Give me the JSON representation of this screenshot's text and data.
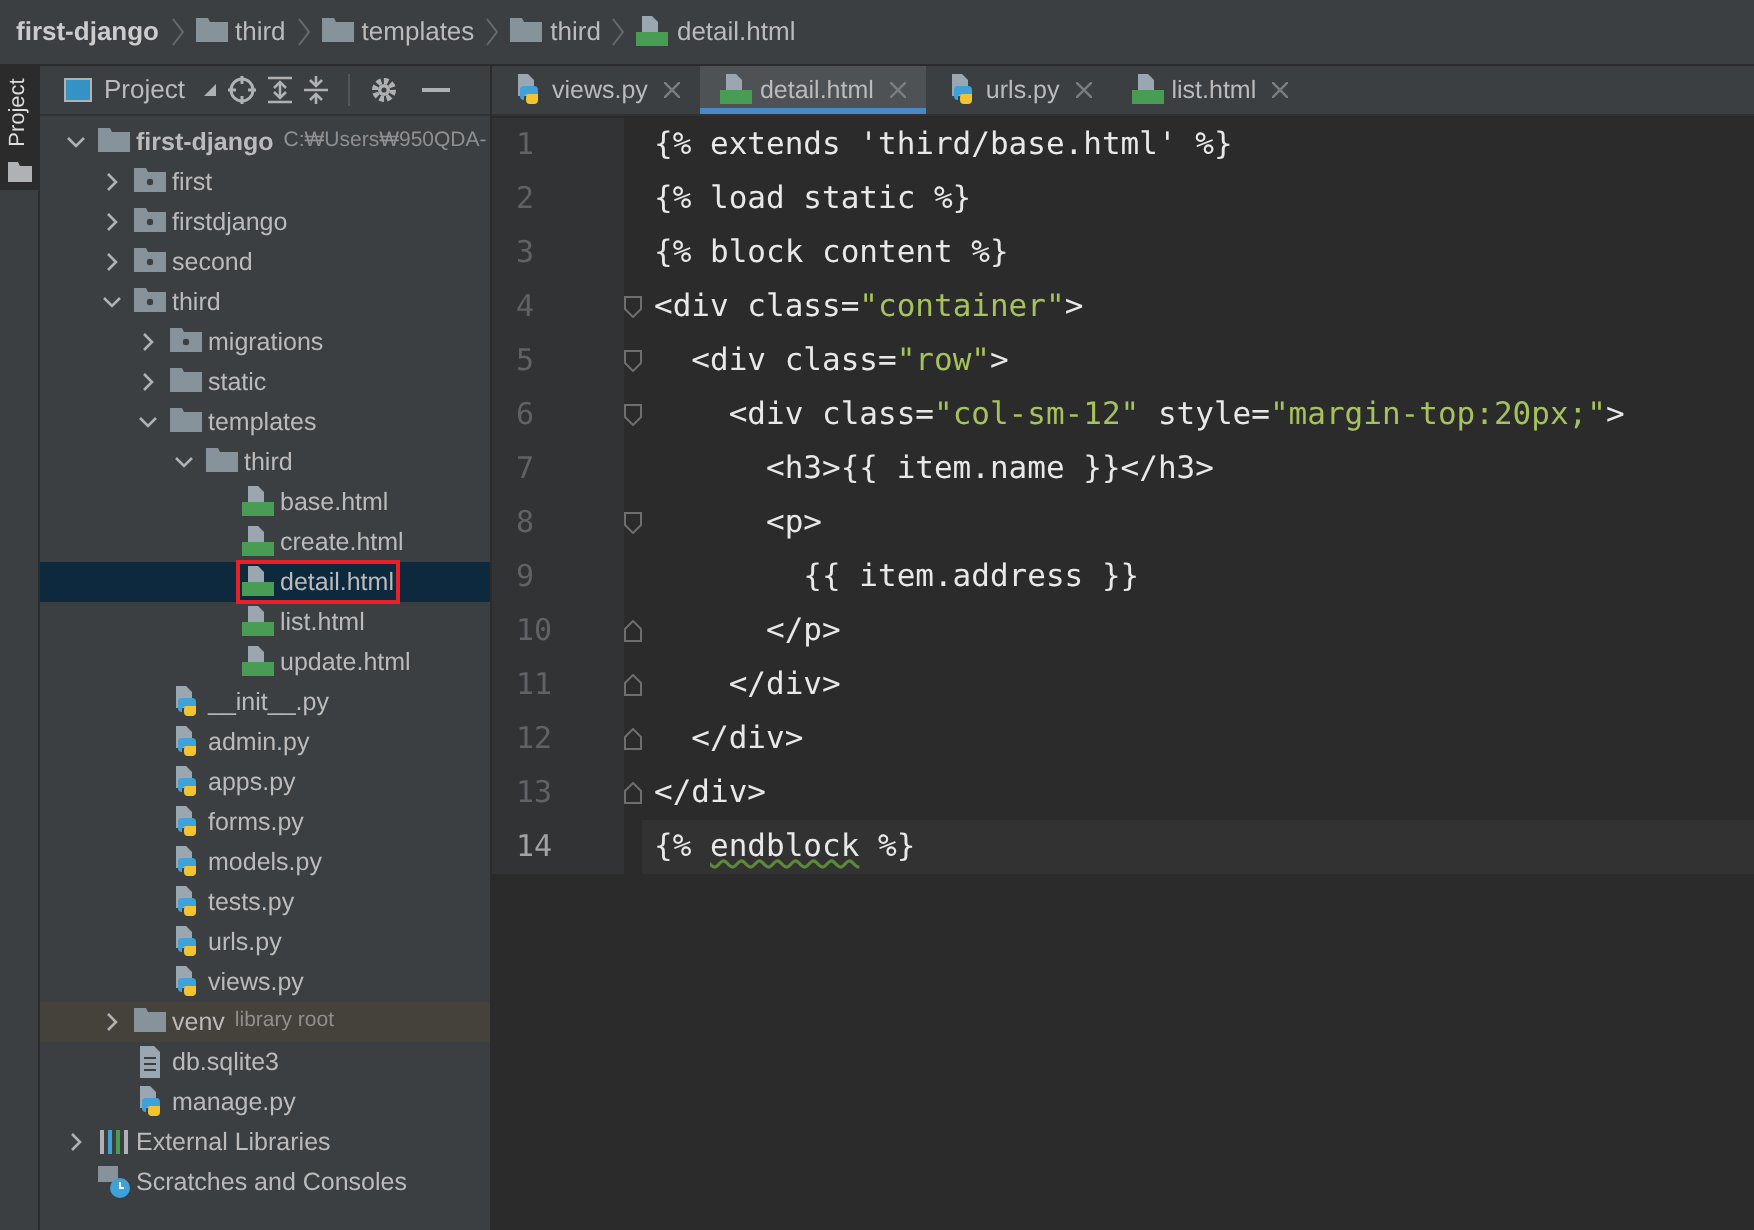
{
  "breadcrumbs": [
    {
      "label": "first-django",
      "kind": "root"
    },
    {
      "label": "third",
      "kind": "folder"
    },
    {
      "label": "templates",
      "kind": "folder"
    },
    {
      "label": "third",
      "kind": "folder"
    },
    {
      "label": "detail.html",
      "kind": "html"
    }
  ],
  "side_strip": {
    "label": "Project"
  },
  "project_toolbar": {
    "label": "Project"
  },
  "tree": [
    {
      "label": "first-django",
      "hint": "C:₩Users₩950QDA-",
      "kind": "folder",
      "expanded": true,
      "selected": false,
      "children": [
        {
          "label": "first",
          "kind": "package",
          "expanded": false,
          "selected": false
        },
        {
          "label": "firstdjango",
          "kind": "package",
          "expanded": false,
          "selected": false
        },
        {
          "label": "second",
          "kind": "package",
          "expanded": false,
          "selected": false
        },
        {
          "label": "third",
          "kind": "package",
          "expanded": true,
          "selected": false,
          "children": [
            {
              "label": "migrations",
              "kind": "package",
              "expanded": false,
              "selected": false
            },
            {
              "label": "static",
              "kind": "folder",
              "expanded": false,
              "selected": false
            },
            {
              "label": "templates",
              "kind": "folder",
              "expanded": true,
              "selected": false,
              "children": [
                {
                  "label": "third",
                  "kind": "folder",
                  "expanded": true,
                  "selected": false,
                  "children": [
                    {
                      "label": "base.html",
                      "kind": "html",
                      "selected": false
                    },
                    {
                      "label": "create.html",
                      "kind": "html",
                      "selected": false
                    },
                    {
                      "label": "detail.html",
                      "kind": "html",
                      "selected": true,
                      "highlighted": true
                    },
                    {
                      "label": "list.html",
                      "kind": "html",
                      "selected": false
                    },
                    {
                      "label": "update.html",
                      "kind": "html",
                      "selected": false
                    }
                  ]
                }
              ]
            },
            {
              "label": "__init__.py",
              "kind": "py",
              "selected": false
            },
            {
              "label": "admin.py",
              "kind": "py",
              "selected": false
            },
            {
              "label": "apps.py",
              "kind": "py",
              "selected": false
            },
            {
              "label": "forms.py",
              "kind": "py",
              "selected": false
            },
            {
              "label": "models.py",
              "kind": "py",
              "selected": false
            },
            {
              "label": "tests.py",
              "kind": "py",
              "selected": false
            },
            {
              "label": "urls.py",
              "kind": "py",
              "selected": false
            },
            {
              "label": "views.py",
              "kind": "py",
              "selected": false
            }
          ]
        },
        {
          "label": "venv",
          "hint": "library root",
          "kind": "libfolder",
          "expanded": false,
          "selected": false
        },
        {
          "label": "db.sqlite3",
          "kind": "file",
          "selected": false
        },
        {
          "label": "manage.py",
          "kind": "py",
          "selected": false
        }
      ]
    },
    {
      "label": "External Libraries",
      "kind": "libraries",
      "expanded": false,
      "selected": false
    },
    {
      "label": "Scratches and Consoles",
      "kind": "scratches",
      "selected": false
    }
  ],
  "tabs": [
    {
      "label": "views.py",
      "kind": "py",
      "selected": false
    },
    {
      "label": "detail.html",
      "kind": "html",
      "selected": true
    },
    {
      "label": "urls.py",
      "kind": "py",
      "selected": false
    },
    {
      "label": "list.html",
      "kind": "html",
      "selected": false
    }
  ],
  "code": [
    {
      "number": "1",
      "fold_start": false,
      "fold_end": false,
      "current": false,
      "tokens": [
        {
          "text": "{% extends 'third/base.html' %}",
          "kind": "plain"
        }
      ]
    },
    {
      "number": "2",
      "fold_start": false,
      "fold_end": false,
      "current": false,
      "tokens": [
        {
          "text": "{% load static %}",
          "kind": "plain"
        }
      ]
    },
    {
      "number": "3",
      "fold_start": false,
      "fold_end": false,
      "current": false,
      "tokens": [
        {
          "text": "{% block content %}",
          "kind": "plain"
        }
      ]
    },
    {
      "number": "4",
      "fold_start": true,
      "fold_end": false,
      "current": false,
      "tokens": [
        {
          "text": "<div class=",
          "kind": "plain"
        },
        {
          "text": "\"container\"",
          "kind": "string"
        },
        {
          "text": ">",
          "kind": "plain"
        }
      ]
    },
    {
      "number": "5",
      "fold_start": true,
      "fold_end": false,
      "current": false,
      "tokens": [
        {
          "text": "  <div class=",
          "kind": "plain"
        },
        {
          "text": "\"row\"",
          "kind": "string"
        },
        {
          "text": ">",
          "kind": "plain"
        }
      ]
    },
    {
      "number": "6",
      "fold_start": true,
      "fold_end": false,
      "current": false,
      "tokens": [
        {
          "text": "    <div class=",
          "kind": "plain"
        },
        {
          "text": "\"col-sm-12\"",
          "kind": "string"
        },
        {
          "text": " style=",
          "kind": "plain"
        },
        {
          "text": "\"margin-top:20px;\"",
          "kind": "string"
        },
        {
          "text": ">",
          "kind": "plain"
        }
      ]
    },
    {
      "number": "7",
      "fold_start": false,
      "fold_end": false,
      "current": false,
      "tokens": [
        {
          "text": "      <h3>{{ item.name }}</h3>",
          "kind": "plain"
        }
      ]
    },
    {
      "number": "8",
      "fold_start": true,
      "fold_end": false,
      "current": false,
      "tokens": [
        {
          "text": "      <p>",
          "kind": "plain"
        }
      ]
    },
    {
      "number": "9",
      "fold_start": false,
      "fold_end": false,
      "current": false,
      "tokens": [
        {
          "text": "        {{ item.address }}",
          "kind": "plain"
        }
      ]
    },
    {
      "number": "10",
      "fold_start": false,
      "fold_end": true,
      "current": false,
      "tokens": [
        {
          "text": "      </p>",
          "kind": "plain"
        }
      ]
    },
    {
      "number": "11",
      "fold_start": false,
      "fold_end": true,
      "current": false,
      "tokens": [
        {
          "text": "    </div>",
          "kind": "plain"
        }
      ]
    },
    {
      "number": "12",
      "fold_start": false,
      "fold_end": true,
      "current": false,
      "tokens": [
        {
          "text": "  </div>",
          "kind": "plain"
        }
      ]
    },
    {
      "number": "13",
      "fold_start": false,
      "fold_end": true,
      "current": false,
      "tokens": [
        {
          "text": "</div>",
          "kind": "plain"
        }
      ]
    },
    {
      "number": "14",
      "fold_start": false,
      "fold_end": false,
      "current": true,
      "tokens": [
        {
          "text": "{% ",
          "kind": "plain"
        },
        {
          "text": "endblock",
          "kind": "warning"
        },
        {
          "text": " %}",
          "kind": "plain"
        }
      ]
    }
  ]
}
